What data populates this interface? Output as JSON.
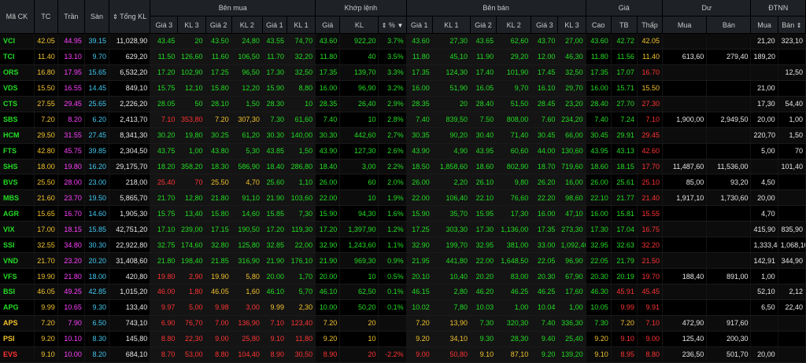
{
  "headers": {
    "symbol": "Mã CK",
    "ref": "TC",
    "ceiling": "Trần",
    "floor": "Sàn",
    "total_vol": "Tổng KL",
    "bid_group": "Bên mua",
    "match_group": "Khớp lệnh",
    "ask_group": "Bên bán",
    "price_group": "Giá",
    "remain_group": "Dư",
    "foreign_group": "ĐTNN",
    "bid_cols": [
      "Giá 3",
      "KL 3",
      "Giá 2",
      "KL 2",
      "Giá 1",
      "KL 1"
    ],
    "match_cols": [
      "Giá",
      "KL",
      "%"
    ],
    "ask_cols": [
      "Giá 1",
      "KL 1",
      "Giá 2",
      "KL 2",
      "Giá 3",
      "KL 3"
    ],
    "price_cols": [
      "Cao",
      "TB",
      "Thấp"
    ],
    "remain_cols": [
      "Mua",
      "Bán"
    ],
    "foreign_cols": [
      "Mua",
      "Bán"
    ]
  },
  "colors": {
    "up": "#22dd22",
    "down": "#ff3333",
    "ref": "#f2c32c",
    "ceiling": "#ff40ff",
    "floor": "#40c8f0",
    "neutral": "#e6e6e6"
  },
  "rows": [
    {
      "sym": "VCI",
      "sc": "u",
      "tc": "42.05",
      "tr": "44.95",
      "sn": "39.15",
      "tot": "11,028,90",
      "b3": "43.45",
      "b3v": "20",
      "b2": "43.50",
      "b2v": "24,80",
      "b1": "43.55",
      "b1v": "74,70",
      "bc": "u",
      "mp": "43.60",
      "mv": "922,20",
      "mpc": "3.7%",
      "mc": "u",
      "a1": "43.60",
      "a1v": "27,30",
      "a2": "43.65",
      "a2v": "62,60",
      "a3": "43.70",
      "a3v": "27,00",
      "ac": "u",
      "hi": "43.60",
      "hc": "u",
      "avg": "42.72",
      "avc": "u",
      "lo": "42.05",
      "lc": "r",
      "rb": "",
      "rs": "",
      "fb": "21,20",
      "fs": "323,10"
    },
    {
      "sym": "TCI",
      "sc": "u",
      "tc": "11.40",
      "tr": "13.10",
      "sn": "9.70",
      "tot": "629,20",
      "b3": "11.50",
      "b3v": "126,60",
      "b2": "11.60",
      "b2v": "106,50",
      "b1": "11.70",
      "b1v": "32,20",
      "bc": "u",
      "mp": "11.80",
      "mv": "40",
      "mpc": "3.5%",
      "mc": "u",
      "a1": "11.80",
      "a1v": "45,10",
      "a2": "11.90",
      "a2v": "29,20",
      "a3": "12.00",
      "a3v": "46,30",
      "ac": "u",
      "hi": "11.80",
      "hc": "u",
      "avg": "11.56",
      "avc": "u",
      "lo": "11.40",
      "lc": "r",
      "rb": "613,60",
      "rs": "279,40",
      "fb": "189,20",
      "fs": ""
    },
    {
      "sym": "ORS",
      "sc": "u",
      "tc": "16.80",
      "tr": "17.95",
      "sn": "15.65",
      "tot": "6,532,20",
      "b3": "17.20",
      "b3v": "102,90",
      "b2": "17.25",
      "b2v": "96,50",
      "b1": "17.30",
      "b1v": "32,50",
      "bc": "u",
      "mp": "17.35",
      "mv": "139,70",
      "mpc": "3.3%",
      "mc": "u",
      "a1": "17.35",
      "a1v": "124,30",
      "a2": "17.40",
      "a2v": "101,90",
      "a3": "17.45",
      "a3v": "32,50",
      "ac": "u",
      "hi": "17.35",
      "hc": "u",
      "avg": "17.07",
      "avc": "u",
      "lo": "16.70",
      "lc": "d",
      "rb": "",
      "rs": "",
      "fb": "",
      "fs": "12,50"
    },
    {
      "sym": "VDS",
      "sc": "u",
      "tc": "15.50",
      "tr": "16.55",
      "sn": "14.45",
      "tot": "849,10",
      "b3": "15.75",
      "b3v": "12,10",
      "b2": "15.80",
      "b2v": "12,20",
      "b1": "15.90",
      "b1v": "8,80",
      "bc": "u",
      "mp": "16.00",
      "mv": "96,90",
      "mpc": "3.2%",
      "mc": "u",
      "a1": "16.00",
      "a1v": "51,90",
      "a2": "16.05",
      "a2v": "9,70",
      "a3": "16.10",
      "a3v": "29,70",
      "ac": "u",
      "hi": "16.00",
      "hc": "u",
      "avg": "15.71",
      "avc": "u",
      "lo": "15.50",
      "lc": "r",
      "rb": "",
      "rs": "",
      "fb": "21,00",
      "fs": ""
    },
    {
      "sym": "CTS",
      "sc": "u",
      "tc": "27.55",
      "tr": "29.45",
      "sn": "25.65",
      "tot": "2,226,20",
      "b3": "28.05",
      "b3v": "50",
      "b2": "28.10",
      "b2v": "1,50",
      "b1": "28.30",
      "b1v": "10",
      "bc": "u",
      "mp": "28.35",
      "mv": "26,40",
      "mpc": "2.9%",
      "mc": "u",
      "a1": "28.35",
      "a1v": "20",
      "a2": "28.40",
      "a2v": "51,50",
      "a3": "28.45",
      "a3v": "23,20",
      "ac": "u",
      "hi": "28.40",
      "hc": "u",
      "avg": "27.70",
      "avc": "u",
      "lo": "27.30",
      "lc": "d",
      "rb": "",
      "rs": "",
      "fb": "17,30",
      "fs": "54,40"
    },
    {
      "sym": "SBS",
      "sc": "u",
      "tc": "7.20",
      "tr": "8.20",
      "sn": "6.20",
      "tot": "2,413,70",
      "b3": "7.10",
      "b3v": "353,80",
      "b3c": "d",
      "b2": "7.20",
      "b2v": "307,30",
      "b2c": "r",
      "b1": "7.30",
      "b1v": "61,60",
      "bc": "u",
      "mp": "7.40",
      "mv": "10",
      "mpc": "2.8%",
      "mc": "u",
      "a1": "7.40",
      "a1v": "839,50",
      "a2": "7.50",
      "a2v": "808,00",
      "a3": "7.60",
      "a3v": "234,20",
      "ac": "u",
      "hi": "7.40",
      "hc": "u",
      "avg": "7.24",
      "avc": "u",
      "lo": "7.10",
      "lc": "d",
      "rb": "1,900,00",
      "rs": "2,949,50",
      "fb": "20,00",
      "fs": "1,00"
    },
    {
      "sym": "HCM",
      "sc": "u",
      "tc": "29.50",
      "tr": "31.55",
      "sn": "27.45",
      "tot": "8,341,30",
      "b3": "30.20",
      "b3v": "19,80",
      "b2": "30.25",
      "b2v": "61,20",
      "b1": "30.30",
      "b1v": "140,00",
      "bc": "u",
      "mp": "30.30",
      "mv": "442,60",
      "mpc": "2.7%",
      "mc": "u",
      "a1": "30.35",
      "a1v": "90,20",
      "a2": "30.40",
      "a2v": "71,40",
      "a3": "30.45",
      "a3v": "66,00",
      "ac": "u",
      "hi": "30.45",
      "hc": "u",
      "avg": "29.91",
      "avc": "u",
      "lo": "29.45",
      "lc": "d",
      "rb": "",
      "rs": "",
      "fb": "220,70",
      "fs": "1,50"
    },
    {
      "sym": "FTS",
      "sc": "u",
      "tc": "42.80",
      "tr": "45.75",
      "sn": "39.85",
      "tot": "2,304,50",
      "b3": "43.75",
      "b3v": "1,00",
      "b2": "43.80",
      "b2v": "5,30",
      "b1": "43.85",
      "b1v": "1,50",
      "bc": "u",
      "mp": "43.90",
      "mv": "127,30",
      "mpc": "2.6%",
      "mc": "u",
      "a1": "43.90",
      "a1v": "4,90",
      "a2": "43.95",
      "a2v": "60,60",
      "a3": "44.00",
      "a3v": "130,60",
      "ac": "u",
      "hi": "43.95",
      "hc": "u",
      "avg": "43.13",
      "avc": "u",
      "lo": "42.60",
      "lc": "d",
      "rb": "",
      "rs": "",
      "fb": "5,00",
      "fs": "70"
    },
    {
      "sym": "SHS",
      "sc": "u",
      "tc": "18.00",
      "tr": "19.80",
      "sn": "16.20",
      "tot": "29,175,70",
      "b3": "18.20",
      "b3v": "358,20",
      "b2": "18.30",
      "b2v": "586,90",
      "b1": "18.40",
      "b1v": "286,80",
      "bc": "u",
      "mp": "18.40",
      "mv": "3,00",
      "mpc": "2.2%",
      "mc": "u",
      "a1": "18.50",
      "a1v": "1,858,60",
      "a2": "18.60",
      "a2v": "802,90",
      "a3": "18.70",
      "a3v": "719,60",
      "ac": "u",
      "hi": "18.60",
      "hc": "u",
      "avg": "18.15",
      "avc": "u",
      "lo": "17.70",
      "lc": "d",
      "rb": "11,487,60",
      "rs": "11,536,00",
      "fb": "",
      "fs": "101,40"
    },
    {
      "sym": "BVS",
      "sc": "u",
      "tc": "25.50",
      "tr": "28.00",
      "sn": "23.00",
      "tot": "218,00",
      "b3": "25.40",
      "b3v": "70",
      "b3c": "d",
      "b2": "25.50",
      "b2v": "4,70",
      "b2c": "r",
      "b1": "25.60",
      "b1v": "1,10",
      "bc": "u",
      "mp": "26.00",
      "mv": "60",
      "mpc": "2.0%",
      "mc": "u",
      "a1": "26.00",
      "a1v": "2,20",
      "a2": "26.10",
      "a2v": "9,80",
      "a3": "26.20",
      "a3v": "16,00",
      "ac": "u",
      "hi": "26.00",
      "hc": "u",
      "avg": "25.61",
      "avc": "u",
      "lo": "25.10",
      "lc": "d",
      "rb": "85,00",
      "rs": "93,20",
      "fb": "4,50",
      "fs": ""
    },
    {
      "sym": "MBS",
      "sc": "u",
      "tc": "21.60",
      "tr": "23.70",
      "sn": "19.50",
      "tot": "5,865,70",
      "b3": "21.70",
      "b3v": "12,80",
      "b2": "21.80",
      "b2v": "91,10",
      "b1": "21.90",
      "b1v": "103,60",
      "bc": "u",
      "mp": "22.00",
      "mv": "10",
      "mpc": "1.9%",
      "mc": "u",
      "a1": "22.00",
      "a1v": "106,40",
      "a2": "22.10",
      "a2v": "76,60",
      "a3": "22.20",
      "a3v": "98,60",
      "ac": "u",
      "hi": "22.10",
      "hc": "u",
      "avg": "21.77",
      "avc": "u",
      "lo": "21.40",
      "lc": "d",
      "rb": "1,917,10",
      "rs": "1,730,60",
      "fb": "20,00",
      "fs": ""
    },
    {
      "sym": "AGR",
      "sc": "u",
      "tc": "15.65",
      "tr": "16.70",
      "sn": "14.60",
      "tot": "1,905,30",
      "b3": "15.75",
      "b3v": "13,40",
      "b2": "15.80",
      "b2v": "14,60",
      "b1": "15.85",
      "b1v": "7,30",
      "bc": "u",
      "mp": "15.90",
      "mv": "94,30",
      "mpc": "1.6%",
      "mc": "u",
      "a1": "15.90",
      "a1v": "35,70",
      "a2": "15.95",
      "a2v": "17,30",
      "a3": "16.00",
      "a3v": "47,10",
      "ac": "u",
      "hi": "16.00",
      "hc": "u",
      "avg": "15.81",
      "avc": "u",
      "lo": "15.55",
      "lc": "d",
      "rb": "",
      "rs": "",
      "fb": "4,70",
      "fs": ""
    },
    {
      "sym": "VIX",
      "sc": "u",
      "tc": "17.00",
      "tr": "18.15",
      "sn": "15.85",
      "tot": "42,751,20",
      "b3": "17.10",
      "b3v": "239,00",
      "b2": "17.15",
      "b2v": "190,50",
      "b1": "17.20",
      "b1v": "119,30",
      "bc": "u",
      "mp": "17.20",
      "mv": "1,397,90",
      "mpc": "1.2%",
      "mc": "u",
      "a1": "17.25",
      "a1v": "303,30",
      "a2": "17.30",
      "a2v": "1,136,00",
      "a3": "17.35",
      "a3v": "273,30",
      "ac": "u",
      "hi": "17.30",
      "hc": "u",
      "avg": "17.04",
      "avc": "u",
      "lo": "16.75",
      "lc": "d",
      "rb": "",
      "rs": "",
      "fb": "415,90",
      "fs": "835,90"
    },
    {
      "sym": "SSI",
      "sc": "u",
      "tc": "32.55",
      "tr": "34.80",
      "sn": "30.30",
      "tot": "22,922,80",
      "b3": "32.75",
      "b3v": "174,60",
      "b2": "32.80",
      "b2v": "125,80",
      "b1": "32.85",
      "b1v": "22,00",
      "bc": "u",
      "mp": "32.90",
      "mv": "1,243,60",
      "mpc": "1.1%",
      "mc": "u",
      "a1": "32.90",
      "a1v": "199,70",
      "a2": "32.95",
      "a2v": "381,00",
      "a3": "33.00",
      "a3v": "1,092,40",
      "ac": "u",
      "hi": "32.95",
      "hc": "u",
      "avg": "32.63",
      "avc": "u",
      "lo": "32.20",
      "lc": "d",
      "rb": "",
      "rs": "",
      "fb": "1,333,40",
      "fs": "1,068,10"
    },
    {
      "sym": "VND",
      "sc": "u",
      "tc": "21.70",
      "tr": "23.20",
      "sn": "20.20",
      "tot": "31,408,60",
      "b3": "21.80",
      "b3v": "198,40",
      "b2": "21.85",
      "b2v": "316,90",
      "b1": "21.90",
      "b1v": "176,10",
      "bc": "u",
      "mp": "21.90",
      "mv": "969,30",
      "mpc": "0.9%",
      "mc": "u",
      "a1": "21.95",
      "a1v": "441,80",
      "a2": "22.00",
      "a2v": "1,648,50",
      "a3": "22.05",
      "a3v": "96,90",
      "ac": "u",
      "hi": "22.05",
      "hc": "u",
      "avg": "21.79",
      "avc": "u",
      "lo": "21.50",
      "lc": "d",
      "rb": "",
      "rs": "",
      "fb": "142,91",
      "fs": "344,90"
    },
    {
      "sym": "VFS",
      "sc": "u",
      "tc": "19.90",
      "tr": "21.80",
      "sn": "18.00",
      "tot": "420,80",
      "b3": "19.80",
      "b3v": "2,90",
      "b3c": "d",
      "b2": "19.90",
      "b2v": "5,80",
      "b2c": "r",
      "b1": "20.00",
      "b1v": "1,70",
      "bc": "u",
      "mp": "20.00",
      "mv": "10",
      "mpc": "0.5%",
      "mc": "u",
      "a1": "20.10",
      "a1v": "10,40",
      "a2": "20.20",
      "a2v": "83,00",
      "a3": "20.30",
      "a3v": "67,90",
      "ac": "u",
      "hi": "20.30",
      "hc": "u",
      "avg": "20.19",
      "avc": "u",
      "lo": "19.70",
      "lc": "d",
      "rb": "188,40",
      "rs": "891,00",
      "fb": "1,00",
      "fs": ""
    },
    {
      "sym": "BSI",
      "sc": "u",
      "tc": "46.05",
      "tr": "49.25",
      "sn": "42.85",
      "tot": "1,015,20",
      "b3": "46.00",
      "b3v": "1,80",
      "b3c": "d",
      "b2": "46.05",
      "b2v": "1,60",
      "b2c": "r",
      "b1": "46.10",
      "b1v": "5,70",
      "bc": "u",
      "mp": "46.10",
      "mv": "62,50",
      "mpc": "0.1%",
      "mc": "u",
      "a1": "46.15",
      "a1v": "2,80",
      "a2": "46.20",
      "a2v": "46.25",
      "a3": "46.25",
      "a3v": "17,60",
      "ac": "u",
      "hi": "46.30",
      "hc": "u",
      "avg": "45.91",
      "avc": "d",
      "lo": "45.45",
      "lc": "d",
      "rb": "",
      "rs": "",
      "fb": "52,10",
      "fs": "2,12"
    },
    {
      "sym": "APG",
      "sc": "u",
      "tc": "9.99",
      "tr": "10.65",
      "sn": "9.30",
      "tot": "133,40",
      "b3": "9.97",
      "b3v": "5,00",
      "b3c": "d",
      "b2": "9.98",
      "b2v": "3,00",
      "b2c": "d",
      "b1": "9.99",
      "b1v": "2,30",
      "bc": "r",
      "mp": "10.00",
      "mv": "50,20",
      "mpc": "0.1%",
      "mc": "u",
      "a1": "10.02",
      "a1v": "7,80",
      "a2": "10.03",
      "a2v": "1,00",
      "a3": "10.04",
      "a3v": "1,00",
      "ac": "u",
      "hi": "10.05",
      "hc": "u",
      "avg": "9.99",
      "avc": "d",
      "lo": "9.91",
      "lc": "d",
      "rb": "",
      "rs": "",
      "fb": "6,50",
      "fs": "22,40"
    },
    {
      "sym": "APS",
      "sc": "r",
      "tc": "7.20",
      "tr": "7.90",
      "sn": "6.50",
      "tot": "743,10",
      "b3": "6.90",
      "b3v": "76,70",
      "b3c": "d",
      "b2": "7.00",
      "b2v": "136,90",
      "b2c": "d",
      "b1": "7.10",
      "b1v": "123,40",
      "bc": "d",
      "mp": "7.20",
      "mv": "20",
      "mpc": "",
      "mc": "r",
      "a1": "7.20",
      "a1v": "13,90",
      "a2": "7.30",
      "a2v": "320,30",
      "a3": "7.40",
      "a3v": "336,30",
      "ac": "u",
      "a1c": "r",
      "hi": "7.30",
      "hc": "u",
      "avg": "7.20",
      "avc": "r",
      "lo": "7.10",
      "lc": "d",
      "rb": "472,90",
      "rs": "917,60",
      "fb": "",
      "fs": ""
    },
    {
      "sym": "PSI",
      "sc": "r",
      "tc": "9.20",
      "tr": "10.10",
      "sn": "8.30",
      "tot": "145,80",
      "b3": "8.80",
      "b3v": "22,30",
      "b3c": "d",
      "b2": "9.00",
      "b2v": "25,80",
      "b2c": "d",
      "b1": "9.10",
      "b1v": "11,80",
      "bc": "d",
      "mp": "9.20",
      "mv": "10",
      "mpc": "",
      "mc": "r",
      "a1": "9.20",
      "a1v": "34,10",
      "a2": "9.30",
      "a2v": "28,30",
      "a3": "9.40",
      "a3v": "25,40",
      "ac": "u",
      "a1c": "r",
      "hi": "9.20",
      "hc": "r",
      "avg": "9.10",
      "avc": "d",
      "lo": "9.00",
      "lc": "d",
      "rb": "125,40",
      "rs": "200,30",
      "fb": "",
      "fs": ""
    },
    {
      "sym": "EVS",
      "sc": "d",
      "tc": "9.10",
      "tr": "10.00",
      "sn": "8.20",
      "tot": "684,10",
      "b3": "8.70",
      "b3v": "53,00",
      "b3c": "d",
      "b2": "8.80",
      "b2v": "104,40",
      "b2c": "d",
      "b1": "8.90",
      "b1v": "30,50",
      "bc": "d",
      "mp": "8.90",
      "mv": "20",
      "mpc": "-2.2%",
      "mc": "d",
      "a1": "9.00",
      "a1v": "50,80",
      "a1c": "d",
      "a2": "9.10",
      "a2v": "87,10",
      "a2c": "r",
      "a3": "9.20",
      "a3v": "139,20",
      "ac": "u",
      "hi": "9.10",
      "hc": "r",
      "avg": "8.95",
      "avc": "d",
      "lo": "8.80",
      "lc": "d",
      "rb": "236,50",
      "rs": "501,70",
      "fb": "20,00",
      "fs": ""
    }
  ]
}
